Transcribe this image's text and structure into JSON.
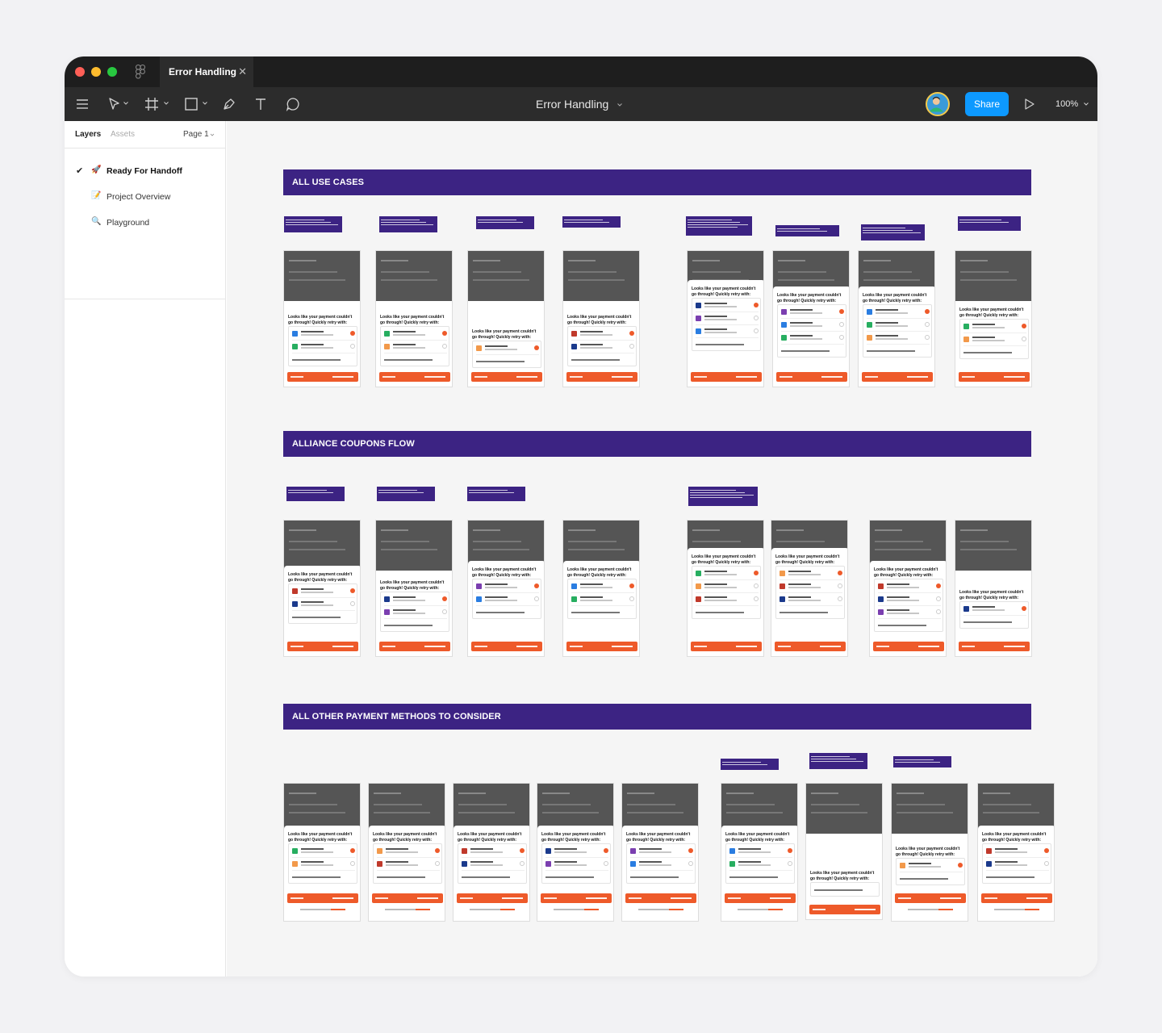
{
  "window": {
    "tab_title": "Error Handling",
    "doc_title": "Error Handling",
    "share_label": "Share",
    "zoom_label": "100%"
  },
  "colors": {
    "accent_blue": "#0d99ff",
    "section_purple": "#3c2383",
    "cta_orange": "#ee5a2a",
    "toolbar_dark": "#2c2c2c"
  },
  "toolbar": {
    "icons": [
      "menu-icon",
      "move-tool-icon",
      "frame-tool-icon",
      "shape-tool-icon",
      "pen-tool-icon",
      "text-tool-icon",
      "comment-tool-icon"
    ]
  },
  "sidebar": {
    "tab_layers": "Layers",
    "tab_assets": "Assets",
    "page_selector": "Page 1",
    "pages": [
      {
        "label": "Ready For Handoff",
        "emoji": "🚀",
        "current": true
      },
      {
        "label": "Project Overview",
        "emoji": "📝",
        "current": false
      },
      {
        "label": "Playground",
        "emoji": "🔍",
        "current": false
      }
    ]
  },
  "sections": [
    {
      "title": "ALL USE CASES"
    },
    {
      "title": "ALLIANCE COUPONS FLOW"
    },
    {
      "title": "ALL OTHER PAYMENT METHODS TO CONSIDER"
    }
  ],
  "frame_title": "Looks like your payment couldn't go through! Quickly retry with:"
}
